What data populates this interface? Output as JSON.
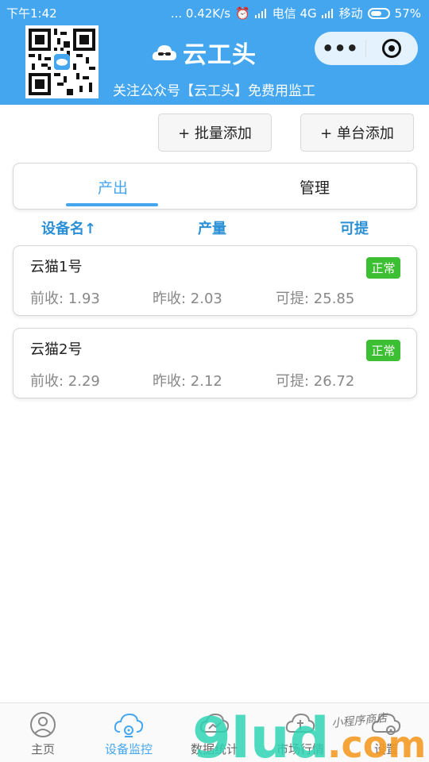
{
  "status_bar": {
    "time": "下午1:42",
    "speed": "0.42K/s",
    "carrier1": "电信 4G",
    "carrier2": "移动",
    "battery": "57%"
  },
  "header": {
    "title": "云工头",
    "subtitle": "关注公众号【云工头】免费用监工",
    "more_label": "•••"
  },
  "actions": {
    "batch_add": "+ 批量添加",
    "single_add": "+ 单台添加"
  },
  "tabs": [
    {
      "label": "产出",
      "active": true
    },
    {
      "label": "管理",
      "active": false
    }
  ],
  "columns": {
    "name": "设备名↑",
    "output": "产量",
    "withdrawable": "可提"
  },
  "devices": [
    {
      "name": "云猫1号",
      "status": "正常",
      "prev": "前收: 1.93",
      "yesterday": "昨收: 2.03",
      "withdrawable": "可提: 25.85"
    },
    {
      "name": "云猫2号",
      "status": "正常",
      "prev": "前收: 2.29",
      "yesterday": "昨收: 2.12",
      "withdrawable": "可提: 26.72"
    }
  ],
  "bottom_nav": [
    {
      "label": "主页",
      "icon": "user-icon",
      "active": false
    },
    {
      "label": "设备监控",
      "icon": "cloud-monitor-icon",
      "active": true
    },
    {
      "label": "数据统计",
      "icon": "cloud-stats-icon",
      "active": false
    },
    {
      "label": "市场行情",
      "icon": "cloud-market-icon",
      "active": false
    },
    {
      "label": "设置",
      "icon": "cloud-gear-icon",
      "active": false
    }
  ],
  "watermark": {
    "brand": "9lud",
    "domain": ".com",
    "handwriting": "小程序商店"
  },
  "colors": {
    "primary": "#45a6f0",
    "status_ok": "#3cbf32",
    "column_header": "#2b8fd6"
  }
}
